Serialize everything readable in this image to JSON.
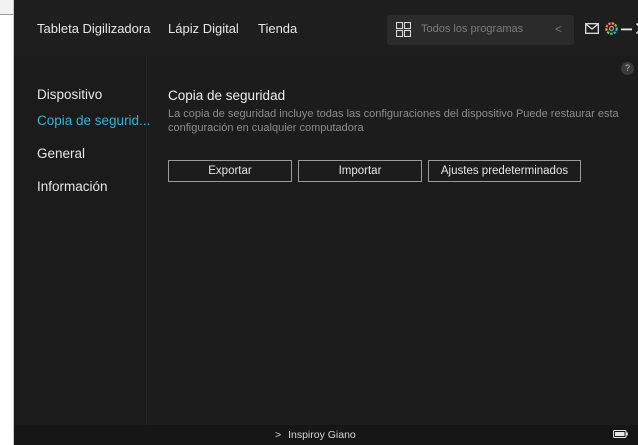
{
  "topnav": {
    "tablet": "Tableta Digilizadora",
    "pen": "Lápiz Digital",
    "store": "Tienda"
  },
  "programs": {
    "placeholder": "Todos los programas",
    "chevron": "<"
  },
  "window_icons": [
    "grid-icon",
    "mail-icon",
    "settings-icon",
    "minimize-icon",
    "close-icon"
  ],
  "accent_color": "#2fb3d6",
  "sidebar": {
    "items": [
      {
        "label": "Dispositivo",
        "active": false
      },
      {
        "label": "Copia de segurid...",
        "active": true
      },
      {
        "label": "General",
        "active": false
      },
      {
        "label": "Información",
        "active": false
      }
    ]
  },
  "main": {
    "help": "?",
    "title": "Copia de seguridad",
    "description": "La copia de seguridad incluye todas las configuraciones del dispositivo Puede restaurar esta configuración en cualquier computadora",
    "buttons": {
      "export": "Exportar",
      "import": "Importar",
      "defaults": "Ajustes predeterminados"
    }
  },
  "footer": {
    "device": "Inspiroy Giano",
    "device_chevron": ">"
  }
}
